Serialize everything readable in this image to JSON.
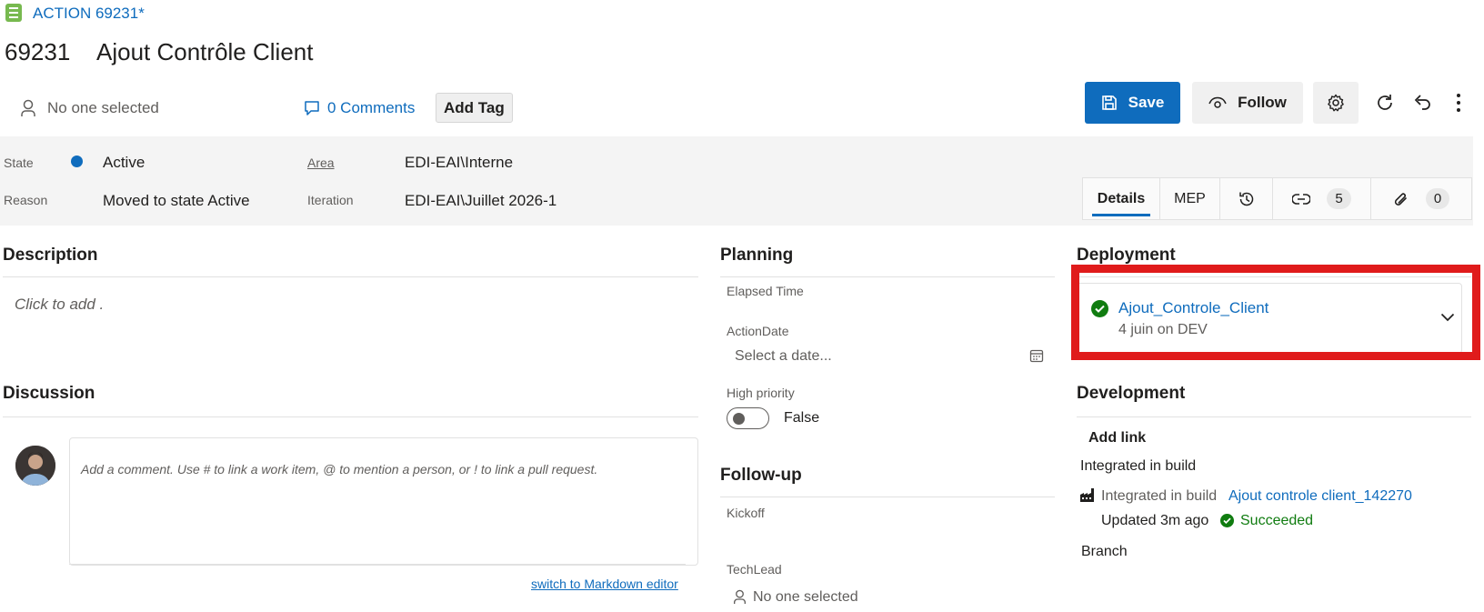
{
  "header": {
    "type_label": "ACTION 69231*",
    "id": "69231",
    "title": "Ajout Contrôle Client",
    "assignee": "No one selected",
    "comments": "0 Comments",
    "add_tag": "Add Tag"
  },
  "toolbar": {
    "save_label": "Save",
    "follow_label": "Follow",
    "settings_icon": "gear-icon",
    "refresh_icon": "refresh-icon",
    "undo_icon": "undo-icon",
    "more_icon": "more-icon"
  },
  "fields": {
    "state_label": "State",
    "state_value": "Active",
    "reason_label": "Reason",
    "reason_value": "Moved to state Active",
    "area_label": "Area",
    "area_value": "EDI-EAI\\Interne",
    "iteration_label": "Iteration",
    "iteration_value": "EDI-EAI\\Juillet 2026-1"
  },
  "tabs": {
    "details": "Details",
    "mep": "MEP",
    "links_count": "5",
    "attachments_count": "0"
  },
  "description": {
    "title": "Description",
    "placeholder": "Click to add ."
  },
  "discussion": {
    "title": "Discussion",
    "placeholder": "Add a comment. Use # to link a work item, @ to mention a person, or ! to link a pull request.",
    "markdown_link": "switch to Markdown editor"
  },
  "planning": {
    "title": "Planning",
    "elapsed_label": "Elapsed Time",
    "action_date_label": "ActionDate",
    "action_date_placeholder": "Select a date...",
    "high_priority_label": "High priority",
    "high_priority_value": "False"
  },
  "followup": {
    "title": "Follow-up",
    "kickoff_label": "Kickoff",
    "techlead_label": "TechLead",
    "techlead_value": "No one selected"
  },
  "deployment": {
    "title": "Deployment",
    "pipeline": "Ajout_Controle_Client",
    "detail": "4 juin on DEV"
  },
  "development": {
    "title": "Development",
    "add_link": "Add link",
    "integrated_heading": "Integrated in build",
    "integrated_prefix": "Integrated in build",
    "build_link": "Ajout controle client_142270",
    "updated": "Updated 3m ago",
    "status": "Succeeded",
    "branch": "Branch"
  },
  "colors": {
    "accent": "#0f6cbd",
    "success": "#107c10",
    "highlight": "#e01b1b",
    "type_icon": "#77b94f"
  }
}
